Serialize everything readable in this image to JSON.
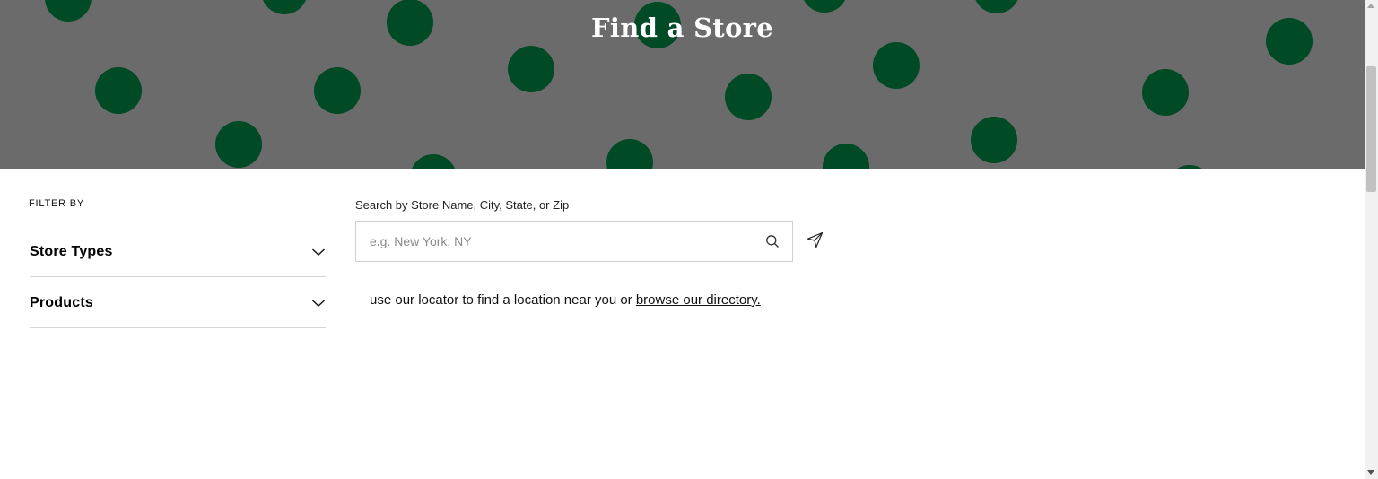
{
  "hero": {
    "title": "Find a Store",
    "background_color": "#6b6b6b",
    "dot_color": "#004a25"
  },
  "filters": {
    "heading": "FILTER BY",
    "items": [
      {
        "label": "Store Types",
        "icon": "chevron-down-icon"
      },
      {
        "label": "Products",
        "icon": "chevron-down-icon"
      }
    ]
  },
  "search": {
    "label": "Search by Store Name, City, State, or Zip",
    "placeholder": "e.g. New York, NY",
    "value": "",
    "search_icon": "search-icon",
    "locate_icon": "location-arrow-icon"
  },
  "locator": {
    "text": "use our locator to find a location near you or ",
    "link_text": "browse our directory."
  }
}
